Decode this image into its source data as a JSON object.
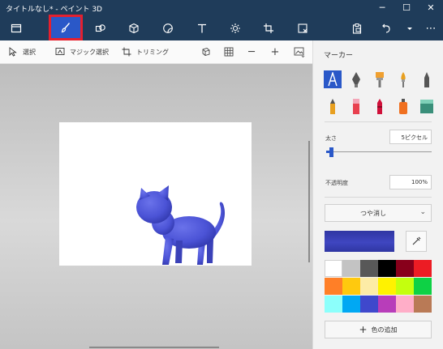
{
  "window": {
    "title": "タイトルなし* - ペイント 3D",
    "minimize": "─",
    "maximize": "☐",
    "close": "✕"
  },
  "toolbar": {
    "tools": [
      "menu-icon",
      "brush-icon",
      "2d-shapes-icon",
      "3d-shapes-icon",
      "stickers-icon",
      "text-icon",
      "effects-icon",
      "canvas-icon",
      "3d-library-icon",
      "paste-icon",
      "undo-icon",
      "more-icon"
    ],
    "overflow": "⋯"
  },
  "context_bar": {
    "select": "選択",
    "magic_select": "マジック選択",
    "crop": "トリミング",
    "zoom_out": "─",
    "zoom_in": "+"
  },
  "panel": {
    "title": "マーカー",
    "thickness_label": "太さ",
    "thickness_value": "5ピクセル",
    "thickness_level": 0.03,
    "opacity_label": "不透明度",
    "opacity_value": "100%",
    "finish": "つや消し",
    "add_color": "色の追加",
    "brushes": [
      "marker",
      "calligraphy-pen",
      "oil-brush",
      "watercolor",
      "pixel-pen",
      "pencil",
      "eraser",
      "crayon",
      "spray-can",
      "fill"
    ],
    "current_color": "#3f46c1",
    "palette": [
      "#ffffff",
      "#c3c3c3",
      "#585858",
      "#000000",
      "#88001b",
      "#ec1c24",
      "#ff7f27",
      "#ffc90e",
      "#fdeca6",
      "#fff200",
      "#c4ff0e",
      "#0ed145",
      "#8cfffb",
      "#00a8f3",
      "#3f48cc",
      "#b83dba",
      "#ffaec8",
      "#b97a56"
    ]
  },
  "canvas": {
    "model_color": "#4b53d6"
  }
}
